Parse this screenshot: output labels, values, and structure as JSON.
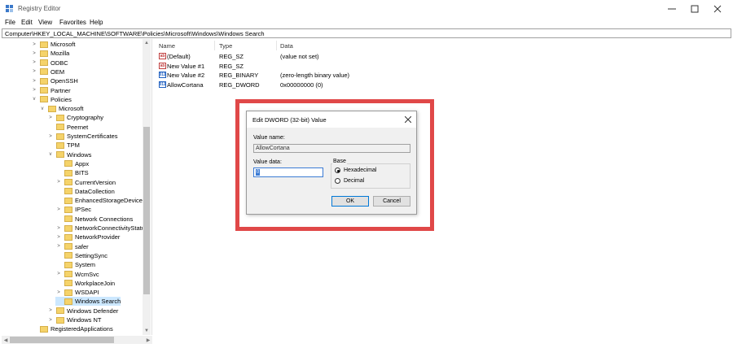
{
  "window": {
    "title": "Registry Editor",
    "min_icon": "minimize-icon",
    "max_icon": "maximize-icon",
    "close_icon": "close-icon"
  },
  "menu": [
    "File",
    "Edit",
    "View",
    "Favorites",
    "Help"
  ],
  "address": "Computer\\HKEY_LOCAL_MACHINE\\SOFTWARE\\Policies\\Microsoft\\Windows\\Windows Search",
  "tree": [
    {
      "label": "Microsoft",
      "level": 0,
      "expander": ">"
    },
    {
      "label": "Mozilla",
      "level": 0,
      "expander": ">"
    },
    {
      "label": "ODBC",
      "level": 0,
      "expander": ">"
    },
    {
      "label": "OEM",
      "level": 0,
      "expander": ">"
    },
    {
      "label": "OpenSSH",
      "level": 0,
      "expander": ">"
    },
    {
      "label": "Partner",
      "level": 0,
      "expander": ">"
    },
    {
      "label": "Policies",
      "level": 0,
      "expander": "v"
    },
    {
      "label": "Microsoft",
      "level": 1,
      "expander": "v"
    },
    {
      "label": "Cryptography",
      "level": 2,
      "expander": ">"
    },
    {
      "label": "Peernet",
      "level": 2,
      "expander": ""
    },
    {
      "label": "SystemCertificates",
      "level": 2,
      "expander": ">"
    },
    {
      "label": "TPM",
      "level": 2,
      "expander": ""
    },
    {
      "label": "Windows",
      "level": 2,
      "expander": "v"
    },
    {
      "label": "Appx",
      "level": 3,
      "expander": ""
    },
    {
      "label": "BITS",
      "level": 3,
      "expander": ""
    },
    {
      "label": "CurrentVersion",
      "level": 3,
      "expander": ">"
    },
    {
      "label": "DataCollection",
      "level": 3,
      "expander": ""
    },
    {
      "label": "EnhancedStorageDevices",
      "level": 3,
      "expander": ""
    },
    {
      "label": "IPSec",
      "level": 3,
      "expander": ">"
    },
    {
      "label": "Network Connections",
      "level": 3,
      "expander": ""
    },
    {
      "label": "NetworkConnectivityStatu",
      "level": 3,
      "expander": ">"
    },
    {
      "label": "NetworkProvider",
      "level": 3,
      "expander": ">"
    },
    {
      "label": "safer",
      "level": 3,
      "expander": ">"
    },
    {
      "label": "SettingSync",
      "level": 3,
      "expander": ""
    },
    {
      "label": "System",
      "level": 3,
      "expander": ""
    },
    {
      "label": "WcmSvc",
      "level": 3,
      "expander": ">"
    },
    {
      "label": "WorkplaceJoin",
      "level": 3,
      "expander": ""
    },
    {
      "label": "WSDAPI",
      "level": 3,
      "expander": ">"
    },
    {
      "label": "Windows Search",
      "level": 3,
      "expander": "",
      "selected": true
    },
    {
      "label": "Windows Defender",
      "level": 2,
      "expander": ">"
    },
    {
      "label": "Windows NT",
      "level": 2,
      "expander": ">"
    },
    {
      "label": "RegisteredApplications",
      "level": 0,
      "expander": ""
    }
  ],
  "columns": {
    "name": "Name",
    "type": "Type",
    "data": "Data"
  },
  "values": [
    {
      "icon": "ab",
      "icon_name": "string-value-icon",
      "name": "(Default)",
      "type": "REG_SZ",
      "data": "(value not set)"
    },
    {
      "icon": "ab",
      "icon_name": "string-value-icon",
      "name": "New Value #1",
      "type": "REG_SZ",
      "data": ""
    },
    {
      "icon": "011",
      "icon_name": "binary-value-icon",
      "name": "New Value #2",
      "type": "REG_BINARY",
      "data": "(zero-length binary value)"
    },
    {
      "icon": "011",
      "icon_name": "binary-value-icon",
      "name": "AllowCortana",
      "type": "REG_DWORD",
      "data": "0x00000000 (0)"
    }
  ],
  "dialog": {
    "title": "Edit DWORD (32-bit) Value",
    "value_name_label": "Value name:",
    "value_name": "AllowCortana",
    "value_data_label": "Value data:",
    "value_data": "0",
    "base_label": "Base",
    "hex_label": "Hexadecimal",
    "dec_label": "Decimal",
    "selected_base": "Hexadecimal",
    "ok_label": "OK",
    "cancel_label": "Cancel"
  },
  "colors": {
    "highlight_box": "#e04848",
    "selection": "#cce8ff",
    "folder": "#f5d36a"
  }
}
